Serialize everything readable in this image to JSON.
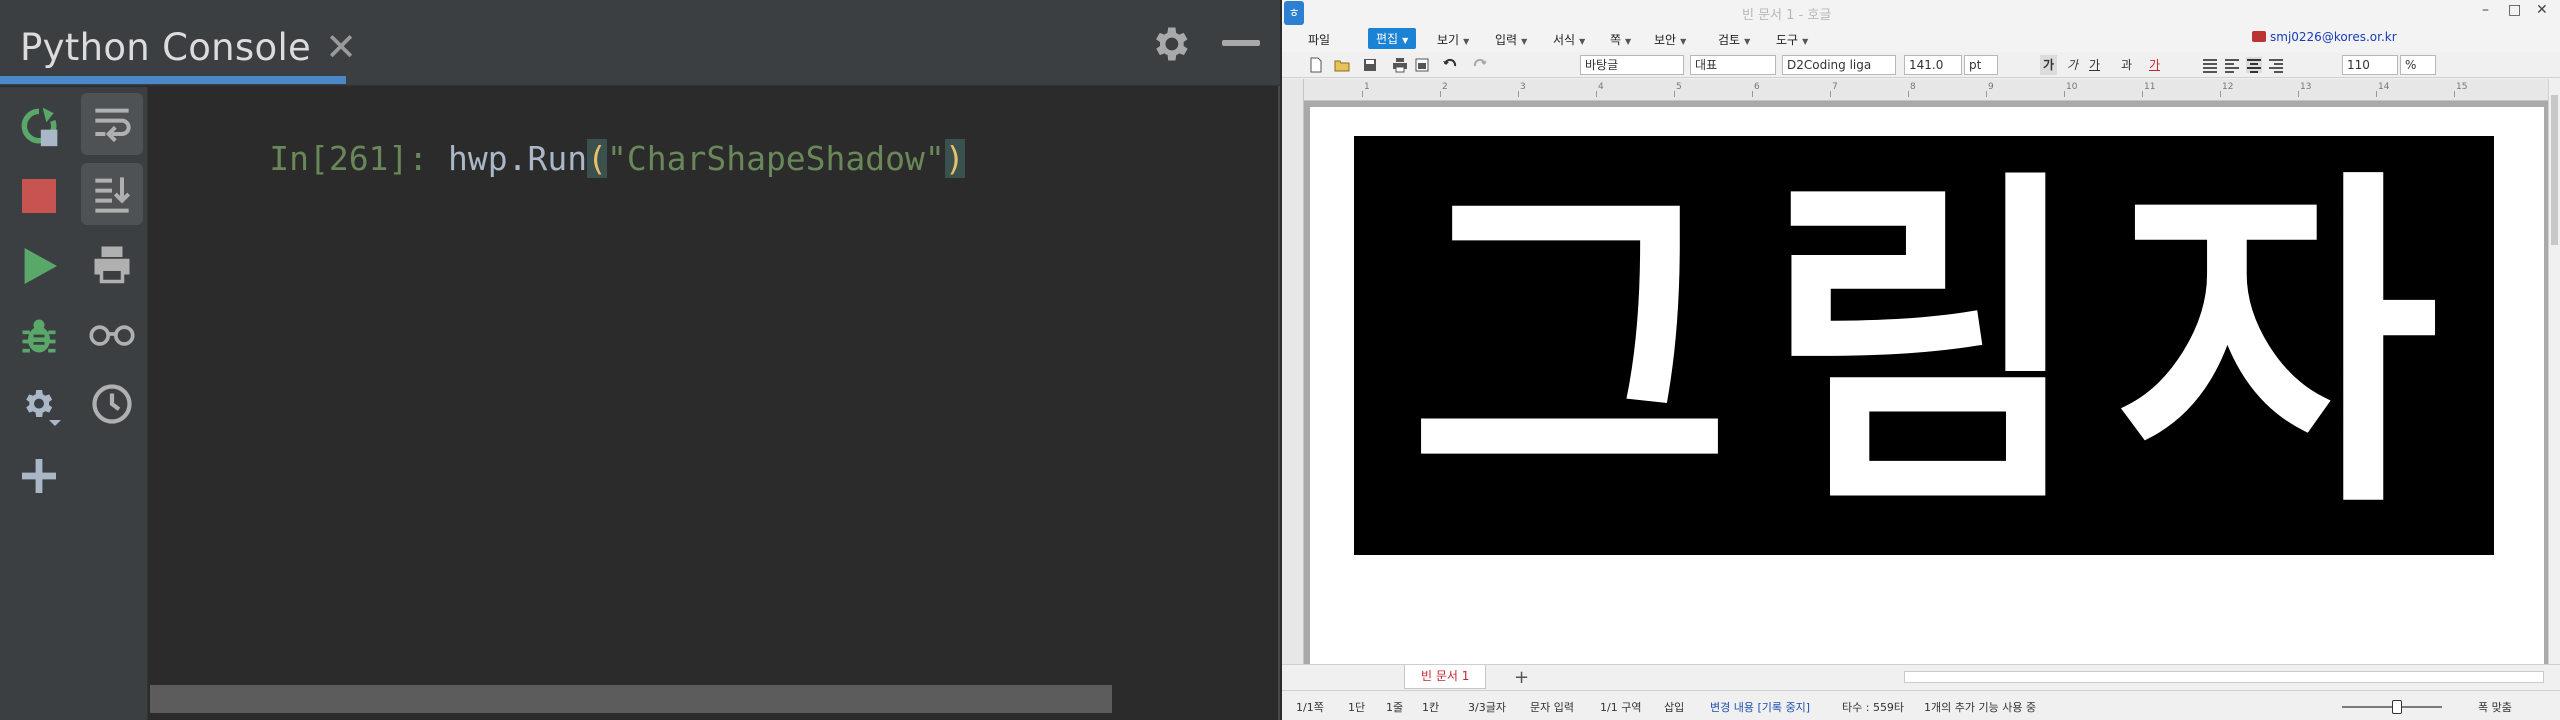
{
  "pycharm": {
    "tab_title": "Python Console",
    "tab_close": "✕",
    "prompt": "In[261]:",
    "code_object": " hwp.Run",
    "code_open": "(",
    "code_string": "\"CharShapeShadow\"",
    "code_close": ")"
  },
  "hwp": {
    "title": "빈 문서 1 - 호글",
    "window_controls": [
      "⤢",
      "✕",
      "?",
      "–",
      "□",
      "✕"
    ],
    "user": "smj0226@kores.or.kr",
    "menus": [
      {
        "label": "파일"
      },
      {
        "label": "편집"
      },
      {
        "label": "보기"
      },
      {
        "label": "입력"
      },
      {
        "label": "서식"
      },
      {
        "label": "쪽"
      },
      {
        "label": "보안"
      },
      {
        "label": "검토"
      },
      {
        "label": "도구"
      }
    ],
    "toolbar": {
      "style": "바탕글",
      "lang": "대표",
      "font": "D2Coding liga",
      "size": "141.0",
      "unit": "pt",
      "bold": "가",
      "italic": "가",
      "underline": "가",
      "strike": "과",
      "color_char": "가",
      "line_spacing": "110",
      "line_spacing_unit": "%"
    },
    "document_text": "그림자",
    "doc_tab": "빈 문서 1",
    "add_tab": "+",
    "status": {
      "page": "1/1쪽",
      "section_col": "1단",
      "line": "1줄",
      "col": "1칸",
      "chars": "3/3글자",
      "input_mode": "문자 입력",
      "section": "1/1 구역",
      "insert": "삽입",
      "track_changes": "변경 내용 [기록 중지]",
      "typing_count": "타수 : 559타",
      "features": "1개의 추가 기능 사용 중",
      "fit": "폭 맞춤"
    },
    "ruler_numbers": [
      "1",
      "2",
      "3",
      "4",
      "5",
      "6",
      "7",
      "8",
      "9",
      "10",
      "11",
      "12",
      "13",
      "14",
      "15"
    ]
  }
}
